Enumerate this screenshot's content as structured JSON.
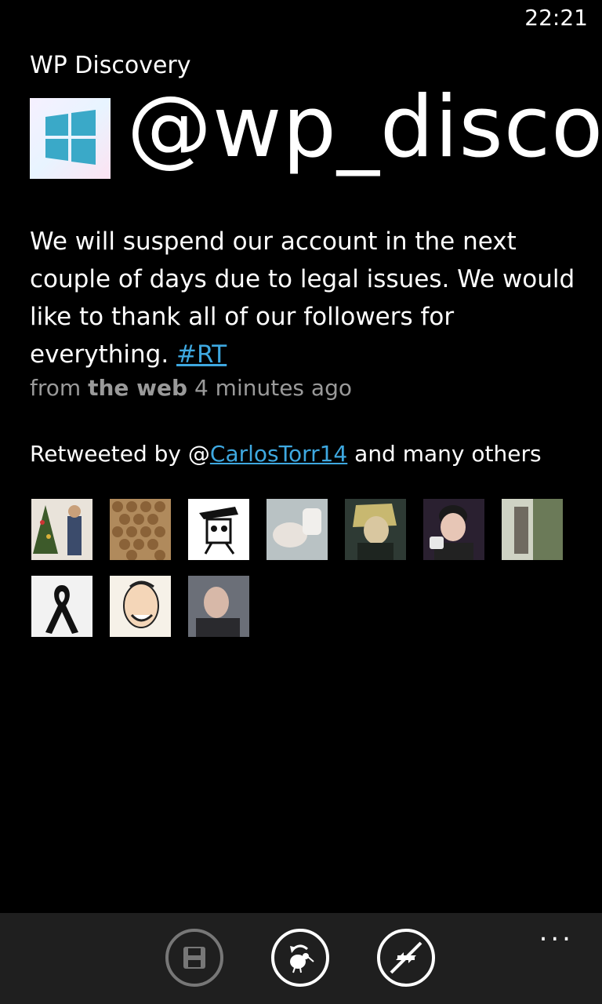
{
  "status": {
    "time": "22:21"
  },
  "app": {
    "title": "WP Discovery"
  },
  "profile": {
    "handle": "@wp_discov",
    "avatar_icon": "windows-logo-icon"
  },
  "tweet": {
    "text": "We will suspend our account in the next couple of days due to legal issues. We would like to thank all of our followers for everything.",
    "hashtag": "#RT",
    "source_prefix": "from",
    "source": "the web",
    "time_ago": "4 minutes ago"
  },
  "retweet": {
    "prefix": "Retweeted by @",
    "user": "CarlosTorr14",
    "suffix": "and many others"
  },
  "retweeters": [
    {
      "name": "retweeter-avatar"
    },
    {
      "name": "retweeter-avatar"
    },
    {
      "name": "retweeter-avatar"
    },
    {
      "name": "retweeter-avatar"
    },
    {
      "name": "retweeter-avatar"
    },
    {
      "name": "retweeter-avatar"
    },
    {
      "name": "retweeter-avatar"
    },
    {
      "name": "retweeter-avatar"
    },
    {
      "name": "retweeter-avatar"
    },
    {
      "name": "retweeter-avatar"
    }
  ],
  "appbar": {
    "buttons": [
      "save-icon",
      "retweet-icon",
      "unfollow-icon"
    ],
    "more": "..."
  },
  "colors": {
    "link": "#3ea8e0",
    "appbar": "#1f1f1f",
    "meta": "#9a9a9a"
  }
}
